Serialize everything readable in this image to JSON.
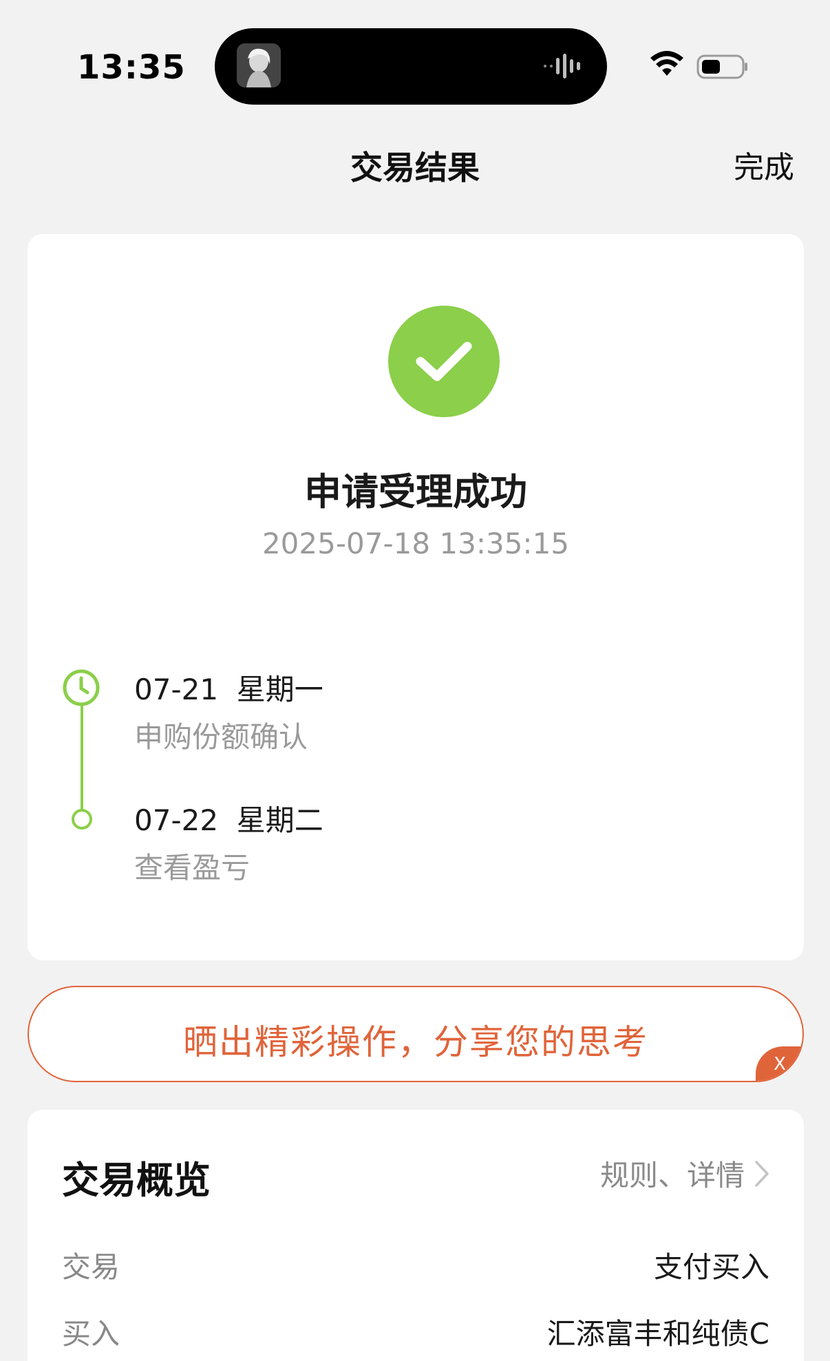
{
  "status_bar": {
    "time": "13:35"
  },
  "nav": {
    "title": "交易结果",
    "done_label": "完成"
  },
  "result": {
    "title": "申请受理成功",
    "timestamp": "2025-07-18 13:35:15",
    "success_color": "#8bcf4a",
    "steps": [
      {
        "date": "07-21",
        "weekday": "星期一",
        "desc": "申购份额确认",
        "icon": "clock-icon"
      },
      {
        "date": "07-22",
        "weekday": "星期二",
        "desc": "查看盈亏",
        "icon": "circle-dot-icon"
      }
    ]
  },
  "share": {
    "text": "晒出精彩操作，分享您的思考",
    "close_label": "X",
    "accent_color": "#e0643a"
  },
  "overview": {
    "title": "交易概览",
    "link_label": "规则、详情",
    "rows": [
      {
        "label": "交易",
        "value": "支付买入"
      },
      {
        "label": "买入",
        "value": "汇添富丰和纯债C"
      }
    ]
  }
}
